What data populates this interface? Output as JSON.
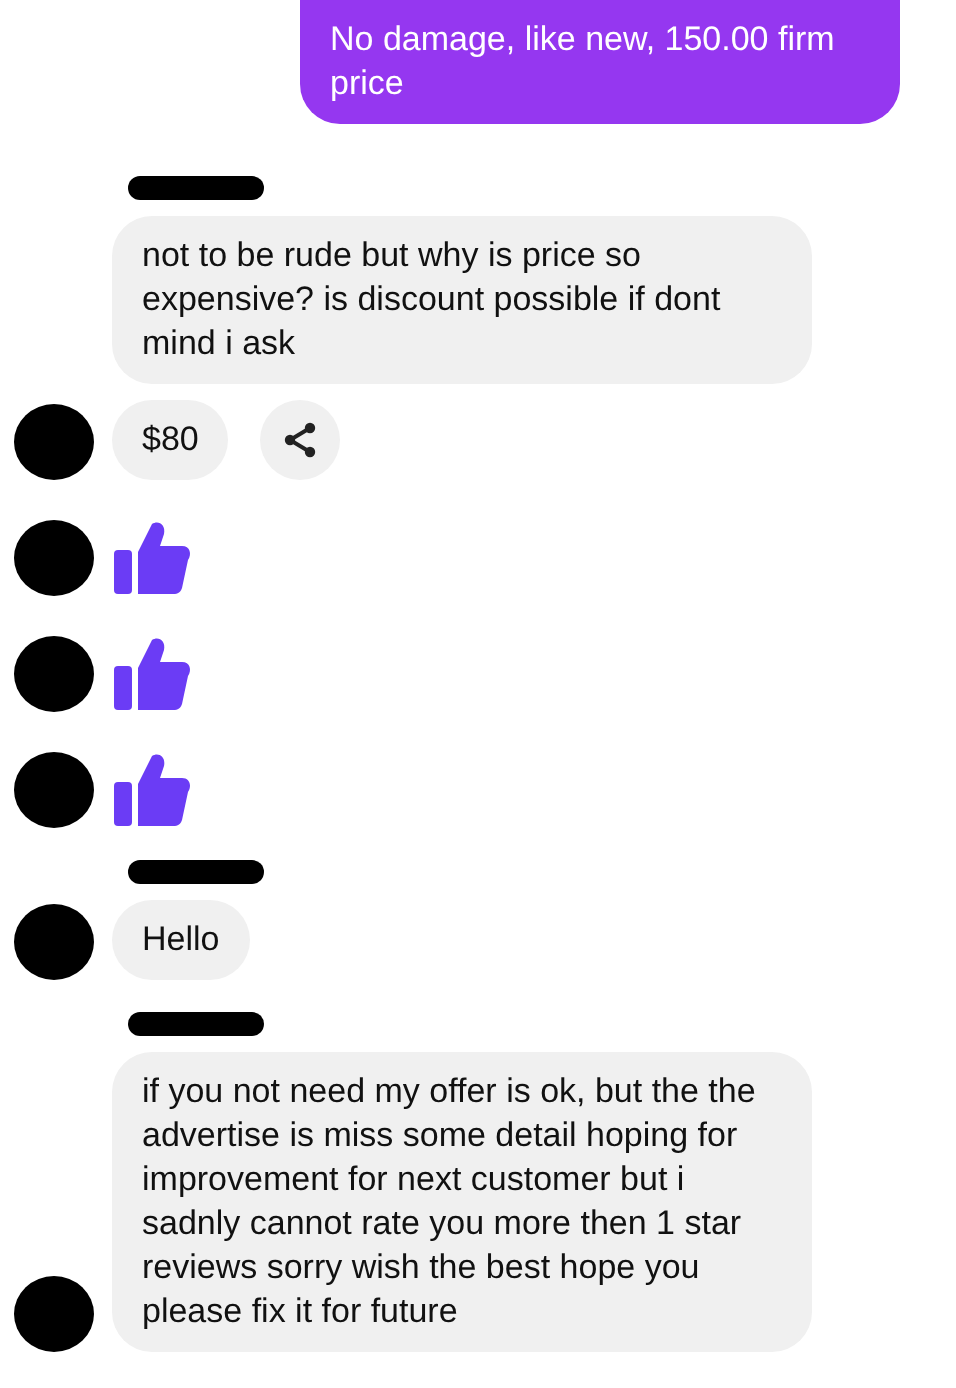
{
  "messages": [
    {
      "kind": "text",
      "outgoing": true,
      "text": "No damage, like new, 150.00 firm price",
      "avatar": false,
      "share_button": false
    },
    {
      "kind": "sender"
    },
    {
      "kind": "text",
      "outgoing": false,
      "text": "not to be rude but why is price so expensive?  is discount possible if dont mind i ask",
      "avatar": false,
      "share_button": false
    },
    {
      "kind": "text",
      "outgoing": false,
      "text": "$80",
      "avatar": true,
      "share_button": true
    },
    {
      "kind": "like",
      "avatar": true
    },
    {
      "kind": "like",
      "avatar": true
    },
    {
      "kind": "like",
      "avatar": true
    },
    {
      "kind": "sender"
    },
    {
      "kind": "text",
      "outgoing": false,
      "text": "Hello",
      "avatar": true,
      "share_button": false
    },
    {
      "kind": "sender"
    },
    {
      "kind": "text",
      "outgoing": false,
      "text": "if you not need my offer is ok, but the the advertise is miss some detail hoping for improvement for next customer but i sadnly cannot rate you more then 1 star reviews sorry wish the best hope you please fix it for future",
      "avatar": true,
      "share_button": false
    }
  ]
}
